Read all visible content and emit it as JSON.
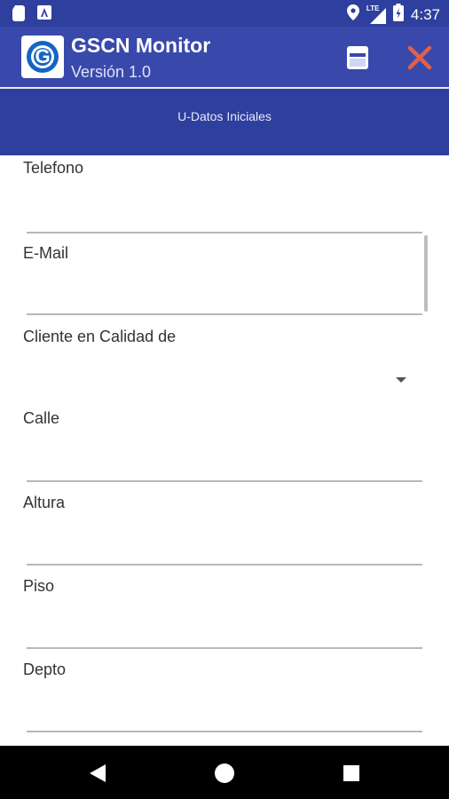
{
  "status_bar": {
    "time": "4:37",
    "network": "LTE"
  },
  "app_bar": {
    "title": "GSCN Monitor",
    "subtitle": "Versión 1.0",
    "logo_letter": "G"
  },
  "section": {
    "title": "U-Datos Iniciales"
  },
  "form": {
    "fields": [
      {
        "label": "Telefono",
        "value": ""
      },
      {
        "label": "E-Mail",
        "value": ""
      },
      {
        "label": "Cliente en Calidad de",
        "value": ""
      },
      {
        "label": "Calle",
        "value": ""
      },
      {
        "label": "Altura",
        "value": ""
      },
      {
        "label": "Piso",
        "value": ""
      },
      {
        "label": "Depto",
        "value": ""
      }
    ]
  },
  "colors": {
    "status_bar": "#2f3f9e",
    "app_bar": "#3949ab",
    "close_icon": "#e0604a",
    "section_band": "#2f3f9e"
  }
}
